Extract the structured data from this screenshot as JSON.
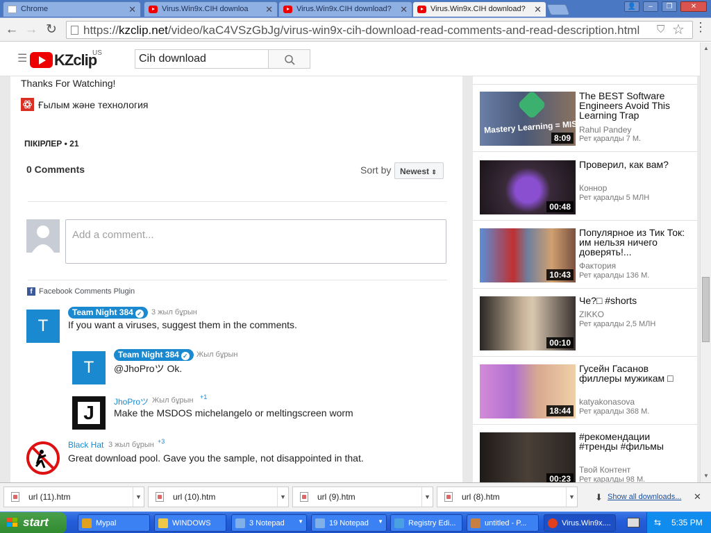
{
  "browser": {
    "tabs": [
      {
        "label": "Chrome",
        "icon": "document-icon",
        "active": false
      },
      {
        "label": "Virus.Win9x.CIH downloa",
        "icon": "youtube-icon",
        "active": false
      },
      {
        "label": "Virus.Win9x.CIH download?",
        "icon": "youtube-icon",
        "active": false
      },
      {
        "label": "Virus.Win9x.CIH download?",
        "icon": "youtube-icon",
        "active": true
      }
    ],
    "url_scheme": "https://",
    "url_domain": "kzclip.net",
    "url_path": "/video/kaC4VSzGbJg/virus-win9x-cih-download-read-comments-and-read-description.html"
  },
  "site": {
    "logo_text": "KZclip",
    "country": "US",
    "search_value": "Cih download"
  },
  "main": {
    "thanks_text": "Thanks For Watching!",
    "category": "Ғылым және технология",
    "comments_header": "ПІКІРЛЕР • 21",
    "fb": {
      "comment_count": "0 Comments",
      "sort_label": "Sort by",
      "sort_value": "Newest",
      "comment_placeholder": "Add a comment...",
      "plugin_label": "Facebook Comments Plugin"
    },
    "comments": [
      {
        "author": "Team Night 384",
        "time": "3 жыл бұрын",
        "text": "If you want a viruses, suggest them in the comments.",
        "avatar": "T"
      },
      {
        "author": "Team Night 384",
        "time": "Жыл бұрын",
        "text": "@JhoProツ Ok.",
        "avatar": "T"
      },
      {
        "author": "JhoProツ",
        "time": "Жыл бұрын",
        "likes": "+1",
        "text": "Make the MSDOS michelangelo or meltingscreen worm",
        "avatar": "J"
      },
      {
        "author": "Black Hat",
        "time": "3 жыл бұрын",
        "likes": "+3",
        "text": "Great download pool. Gave you the sample, not disappointed in that."
      }
    ]
  },
  "sidebar": {
    "videos": [
      {
        "title": "The BEST Software Engineers Avoid This Learning Trap",
        "channel": "Rahul Pandey",
        "views": "Рет қаралды 7 М.",
        "duration": "8:09",
        "thumb_text": "Mastery Learning = MISTAKE"
      },
      {
        "title": "Проверил, как вам?",
        "channel": "Коннор",
        "views": "Рет қаралды 5 МЛН",
        "duration": "00:48"
      },
      {
        "title": "Популярное из Тик Ток: им нельзя ничего доверять!...",
        "channel": "Фактория",
        "views": "Рет қаралды 136 М.",
        "duration": "10:43"
      },
      {
        "title": "Че?□ #shorts",
        "channel": "ZIKKO",
        "views": "Рет қаралды 2,5 МЛН",
        "duration": "00:10"
      },
      {
        "title": "Гусейн Гасанов филлеры мужикам □",
        "channel": "katyakonasova",
        "views": "Рет қаралды 368 М.",
        "duration": "18:44"
      },
      {
        "title": "#рекомендации #тренды #фильмы",
        "channel": "Твой Контент",
        "views": "Рет қаралды 98 М.",
        "duration": "00:23"
      }
    ]
  },
  "downloads": {
    "items": [
      "url (11).htm",
      "url (10).htm",
      "url (9).htm",
      "url (8).htm"
    ],
    "show_all": "Show all downloads..."
  },
  "taskbar": {
    "start": "start",
    "items": [
      {
        "label": "Mypal",
        "icon_color": "#e0a020"
      },
      {
        "label": "WINDOWS",
        "icon_color": "#f0c848"
      },
      {
        "label": "3 Notepad",
        "icon_color": "#7fb0e8"
      },
      {
        "label": "19 Notepad",
        "icon_color": "#7fb0e8"
      },
      {
        "label": "Registry Edi...",
        "icon_color": "#4aa0e0"
      },
      {
        "label": "untitled - P...",
        "icon_color": "#c88040"
      },
      {
        "label": "Virus.Win9x....",
        "icon_color": "#e04020"
      }
    ],
    "time": "5:35 PM"
  },
  "colors": {
    "accent": "#1a89d0",
    "youtube_red": "#e00000"
  }
}
